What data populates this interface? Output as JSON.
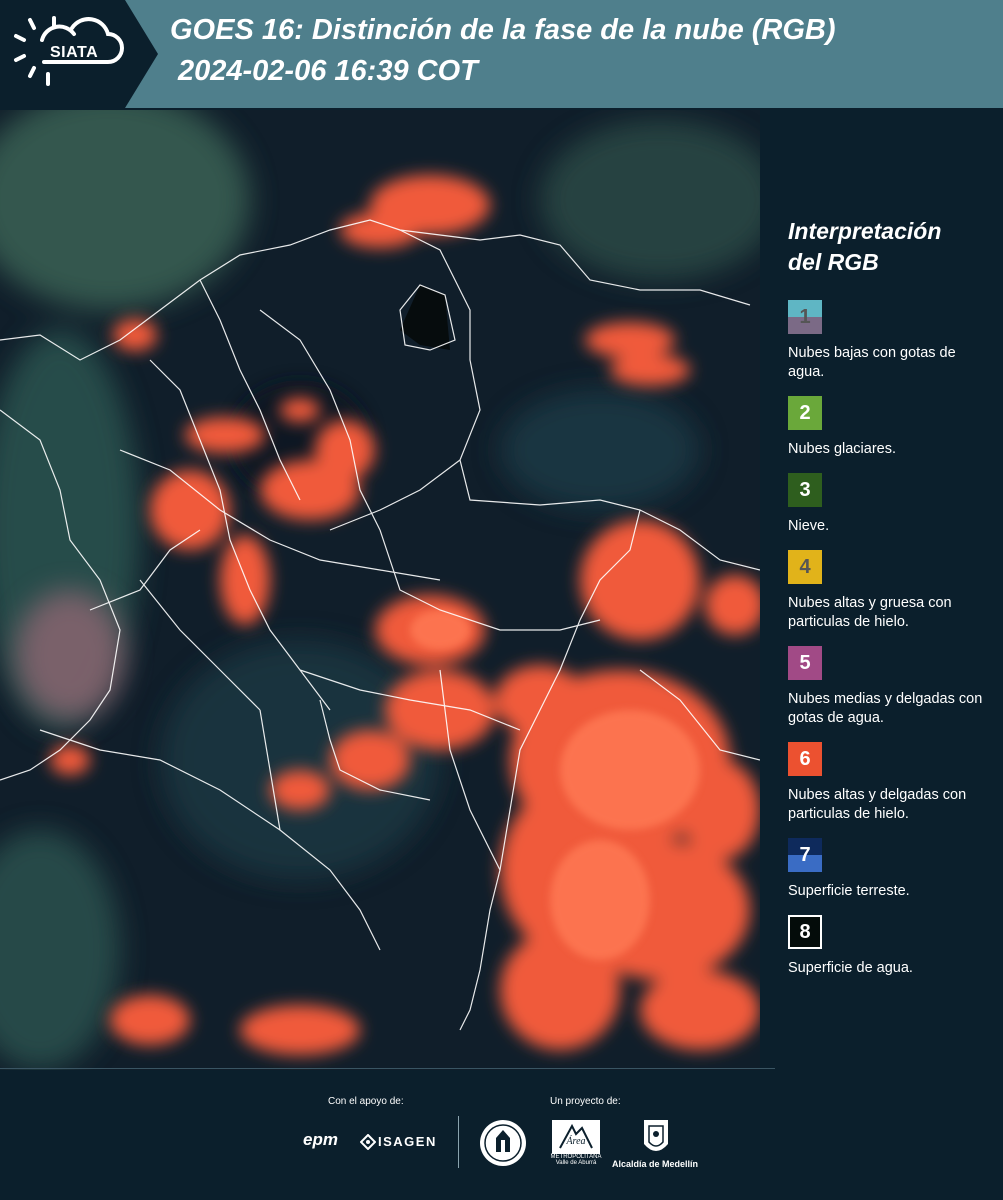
{
  "header": {
    "logo_text": "SIATA",
    "title_line1": "GOES 16: Distinción de la fase de la nube (RGB)",
    "title_line2": "2024-02-06 16:39 COT"
  },
  "legend": {
    "title_line1": "Interpretación",
    "title_line2": "del RGB",
    "items": [
      {
        "num": "1",
        "label": "Nubes bajas con gotas de agua.",
        "color_top": "#5fb6c4",
        "color_bottom": "#7b6a86",
        "text_color": "#555555"
      },
      {
        "num": "2",
        "label": "Nubes glaciares.",
        "color": "#6aa83a",
        "text_color": "#ffffff"
      },
      {
        "num": "3",
        "label": "Nieve.",
        "color": "#2e5e1e",
        "text_color": "#ffffff"
      },
      {
        "num": "4",
        "label": "Nubes altas y gruesa con particulas de hielo.",
        "color": "#e1b31a",
        "text_color": "#555555"
      },
      {
        "num": "5",
        "label": "Nubes medias y delgadas con gotas de agua.",
        "color": "#a14a86",
        "text_color": "#ffffff"
      },
      {
        "num": "6",
        "label": "Nubes altas y delgadas con particulas de hielo.",
        "color": "#ec5130",
        "text_color": "#ffffff"
      },
      {
        "num": "7",
        "label": "Superficie terreste.",
        "color_top": "#0e2a5c",
        "color_bottom": "#3a6cc4",
        "text_color": "#ffffff"
      },
      {
        "num": "8",
        "label": "Superficie de agua.",
        "color": "#040c0a",
        "text_color": "#ffffff",
        "border": "#ffffff"
      }
    ]
  },
  "footer": {
    "apoyo_label": "Con el apoyo de:",
    "proyecto_label": "Un proyecto de:",
    "epm": "epm",
    "isagen": "ISAGEN",
    "area_text": "METROPOLITANA Valle de Aburrá",
    "alcaldia": "Alcaldía de Medellín"
  },
  "colors": {
    "header_bg": "#4f7f8c",
    "page_bg": "#0b1f2c",
    "cloud_orange": "#f05a3a",
    "border_lines": "#ffffff"
  }
}
